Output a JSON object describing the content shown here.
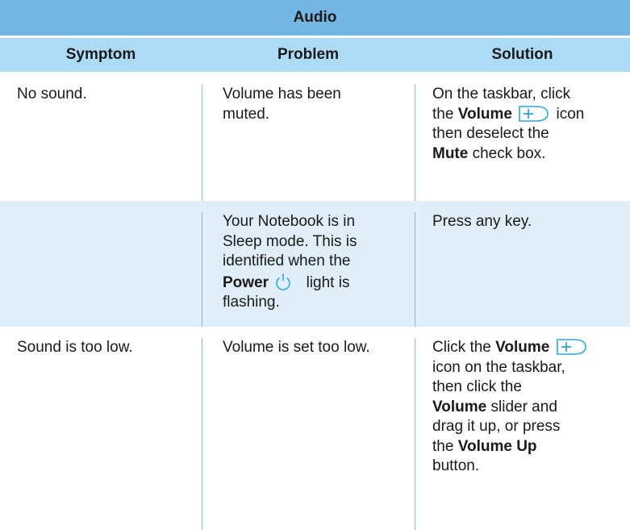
{
  "table": {
    "title": "Audio",
    "headers": {
      "symptom": "Symptom",
      "problem": "Problem",
      "solution": "Solution"
    },
    "rows": [
      {
        "symptom": "No sound.",
        "problem_l1": "Volume has been",
        "problem_l2": "muted.",
        "sol_l1": "On the taskbar, click",
        "sol_l2_a": "the",
        "sol_l2_b": "Volume",
        "sol_l2_c": "icon",
        "sol_l3": "then deselect the",
        "sol_l4_a": "Mute",
        "sol_l4_b": "check box."
      },
      {
        "symptom": "",
        "problem_l1": "Your Notebook is in",
        "problem_l2": "Sleep mode. This is",
        "problem_l3": "identified when the",
        "problem_l4_a": "Power",
        "problem_l4_b": "light is",
        "problem_l5": "flashing.",
        "sol_l1": "Press any key."
      },
      {
        "symptom": "Sound is too low.",
        "problem_l1": "Volume is set too low.",
        "sol_l1_a": "Click the",
        "sol_l1_b": "Volume",
        "sol_l2": "icon on the taskbar,",
        "sol_l3": "then click the",
        "sol_l4_a": "Volume",
        "sol_l4_b": "slider and",
        "sol_l5": "drag it up, or press",
        "sol_l6_a": "the",
        "sol_l6_b": "Volume Up",
        "sol_l7": "button."
      }
    ]
  },
  "icons": {
    "volume": "volume-icon",
    "power": "power-icon",
    "accent": "#2aa8e0"
  }
}
